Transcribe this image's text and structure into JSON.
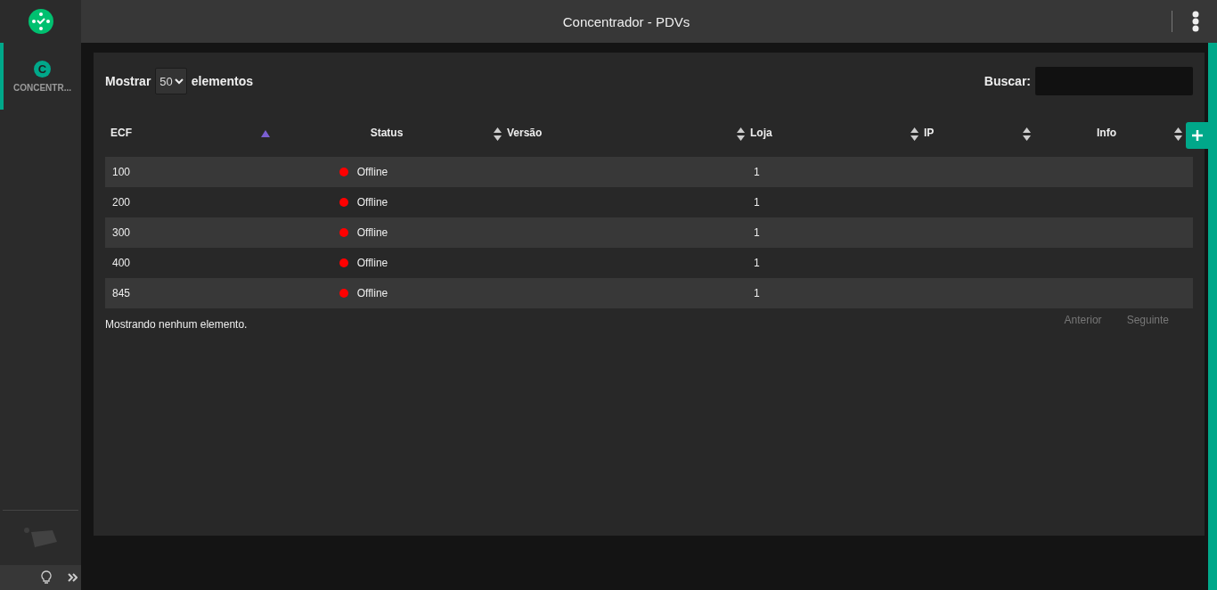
{
  "header": {
    "title": "Concentrador - PDVs"
  },
  "sidebar": {
    "items": [
      {
        "letter": "C",
        "label": "CONCENTR...",
        "selected": true
      }
    ]
  },
  "controls": {
    "show_prefix": "Mostrar",
    "page_size": "50",
    "show_suffix": "elementos",
    "search_label": "Buscar:"
  },
  "table": {
    "columns": [
      {
        "label": "ECF",
        "sorted": true
      },
      {
        "label": "Status",
        "sorted": false
      },
      {
        "label": "Versão",
        "sorted": false
      },
      {
        "label": "Loja",
        "sorted": false
      },
      {
        "label": "IP",
        "sorted": false
      },
      {
        "label": "Info",
        "sorted": false
      }
    ],
    "rows": [
      {
        "ecf": "100",
        "status": "Offline",
        "color": "#ff0000",
        "loja": "1"
      },
      {
        "ecf": "200",
        "status": "Offline",
        "color": "#ff0000",
        "loja": "1"
      },
      {
        "ecf": "300",
        "status": "Offline",
        "color": "#ff0000",
        "loja": "1"
      },
      {
        "ecf": "400",
        "status": "Offline",
        "color": "#ff0000",
        "loja": "1"
      },
      {
        "ecf": "845",
        "status": "Offline",
        "color": "#ff0000",
        "loja": "1"
      }
    ]
  },
  "footer": {
    "info": "Mostrando nenhum elemento.",
    "pagination": [
      {
        "label": "Anterior",
        "disabled": true
      },
      {
        "label": "Seguinte",
        "disabled": true
      }
    ]
  }
}
